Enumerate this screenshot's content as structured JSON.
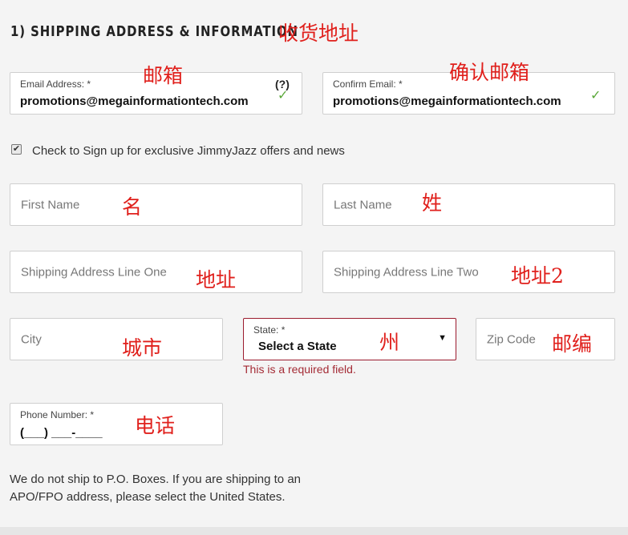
{
  "section": {
    "title": "1) SHIPPING ADDRESS & INFORMATION",
    "title_note": "收货地址"
  },
  "email": {
    "label": "Email Address: *",
    "value": "promotions@megainformationtech.com",
    "help": "(?)",
    "note": "邮箱"
  },
  "confirm_email": {
    "label": "Confirm Email: *",
    "value": "promotions@megainformationtech.com",
    "note": "确认邮箱"
  },
  "newsletter": {
    "checked": true,
    "label": "Check to Sign up for exclusive JimmyJazz offers and news"
  },
  "first_name": {
    "placeholder": "First Name",
    "note": "名"
  },
  "last_name": {
    "placeholder": "Last Name",
    "note": "姓"
  },
  "address1": {
    "placeholder": "Shipping Address Line One",
    "note": "地址"
  },
  "address2": {
    "placeholder": "Shipping Address Line Two",
    "note": "地址2"
  },
  "city": {
    "placeholder": "City",
    "note": "城市"
  },
  "state": {
    "label": "State: *",
    "selected": "Select a State",
    "error": "This is a required field.",
    "note": "州"
  },
  "zip": {
    "placeholder": "Zip Code",
    "note": "邮编"
  },
  "phone": {
    "label": "Phone Number: *",
    "value": "(___) ___-____",
    "note": "电话"
  },
  "po_box_note": "We do not ship to P.O. Boxes. If you are shipping to an APO/FPO address, please select the United States.",
  "colors": {
    "annotation": "#e0201c",
    "error": "#a42b35",
    "valid_check": "#5aa839"
  }
}
